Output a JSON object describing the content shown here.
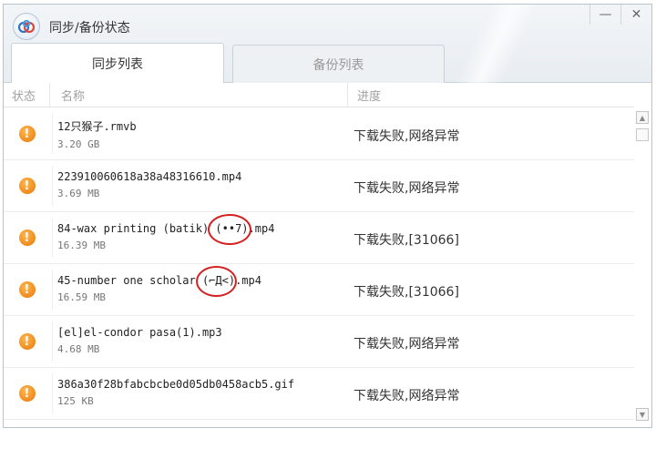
{
  "window": {
    "title": "同步/备份状态",
    "minimize_label": "—",
    "close_label": "✕"
  },
  "tabs": [
    {
      "label": "同步列表",
      "active": true
    },
    {
      "label": "备份列表",
      "active": false
    }
  ],
  "columns": {
    "status": "状态",
    "name": "名称",
    "progress": "进度"
  },
  "rows": [
    {
      "name": "12只猴子.rmvb",
      "size": "3.20 GB",
      "progress": "下载失败,网络异常",
      "status_icon": "warning-icon"
    },
    {
      "name": "223910060618a38a48316610.mp4",
      "size": "3.69 MB",
      "progress": "下载失败,网络异常",
      "status_icon": "warning-icon"
    },
    {
      "name": "84-wax printing (batik) (••7).mp4",
      "size": "16.39 MB",
      "progress": "下载失败,[31066]",
      "status_icon": "warning-icon"
    },
    {
      "name": "45-number one scholar (⌐Д<).mp4",
      "size": "16.59 MB",
      "progress": "下载失败,[31066]",
      "status_icon": "warning-icon"
    },
    {
      "name": "[el]el-condor pasa(1).mp3",
      "size": "4.68 MB",
      "progress": "下载失败,网络异常",
      "status_icon": "warning-icon"
    },
    {
      "name": "386a30f28bfabcbcbe0d05db0458acb5.gif",
      "size": "125 KB",
      "progress": "下载失败,网络异常",
      "status_icon": "warning-icon"
    }
  ],
  "colors": {
    "warning": "#f08a1c",
    "annotation": "#d42020"
  }
}
